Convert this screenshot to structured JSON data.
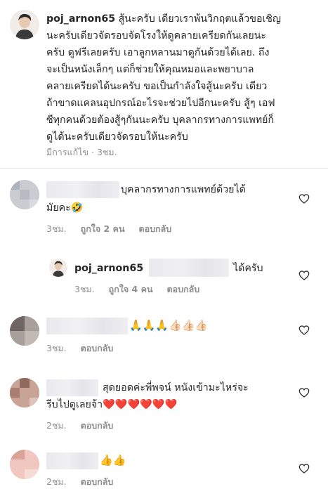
{
  "post": {
    "username": "poj_arnon65",
    "caption_lines": [
      "สู้นะครับ เดียวเราพ้นวิกฤตแล้วขอเชิญ",
      "นะครับเดียวจัดรอบจัดโรงให้ดูคลายเครียดกันเลยนะ",
      "ครับ ดูฟรีเลยครับ เอาลูกหลานมาดูกันด้วยได้เลย. ถึง",
      "จะเป็นหนังเล็กๆ แต่ก็ช่วยให้คุณหมอและพยาบาล",
      "คลายเครียดได้นะครับ ขอเป็นกำลังใจสู้นะครับ เดียว",
      "ถ้าขาดแคลนอุปกรณ์อะไรจะช่วยไปอีกนะครับ สู้ๆ เอฟ",
      "ซีทุกคนด้วยต้องสู้ๆกันนะครับ บุคลากรทางการแพทย์ก็",
      "ดูได้นะครับเดียวจัดรอบให้นะครับ"
    ],
    "edited_label": "มีการแก้ไข",
    "time": "3ชม."
  },
  "comments": [
    {
      "text_lines": [
        "บุคลากรทางการแพทย์ด้วยได้",
        "มัยคะ🤣"
      ],
      "time": "3ชม.",
      "likes": "ถูกใจ 2 คน",
      "reply": "ตอบกลับ"
    },
    {
      "username": "poj_arnon65",
      "text": "ได้ครับ",
      "time": "3ชม.",
      "likes": "ถูกใจ 4 คน",
      "reply": "ตอบกลับ"
    },
    {
      "text": "🙏🙏🙏👍🏻👍🏻👍🏻",
      "time": "3ชม.",
      "reply": "ตอบกลับ"
    },
    {
      "text_lines": [
        "สุดยอดค่ะพี่พจน์ หนังเข้ามะไหร่จะ",
        "รีบไปดูเลยจ้า❤️❤️❤️❤️❤️❤️"
      ],
      "time": "2ชม.",
      "reply": "ตอบกลับ"
    },
    {
      "text": "👍👍",
      "time": "2ชม.",
      "reply": "ตอบกลับ"
    }
  ],
  "icons": {
    "like": "heart-outline-icon"
  }
}
